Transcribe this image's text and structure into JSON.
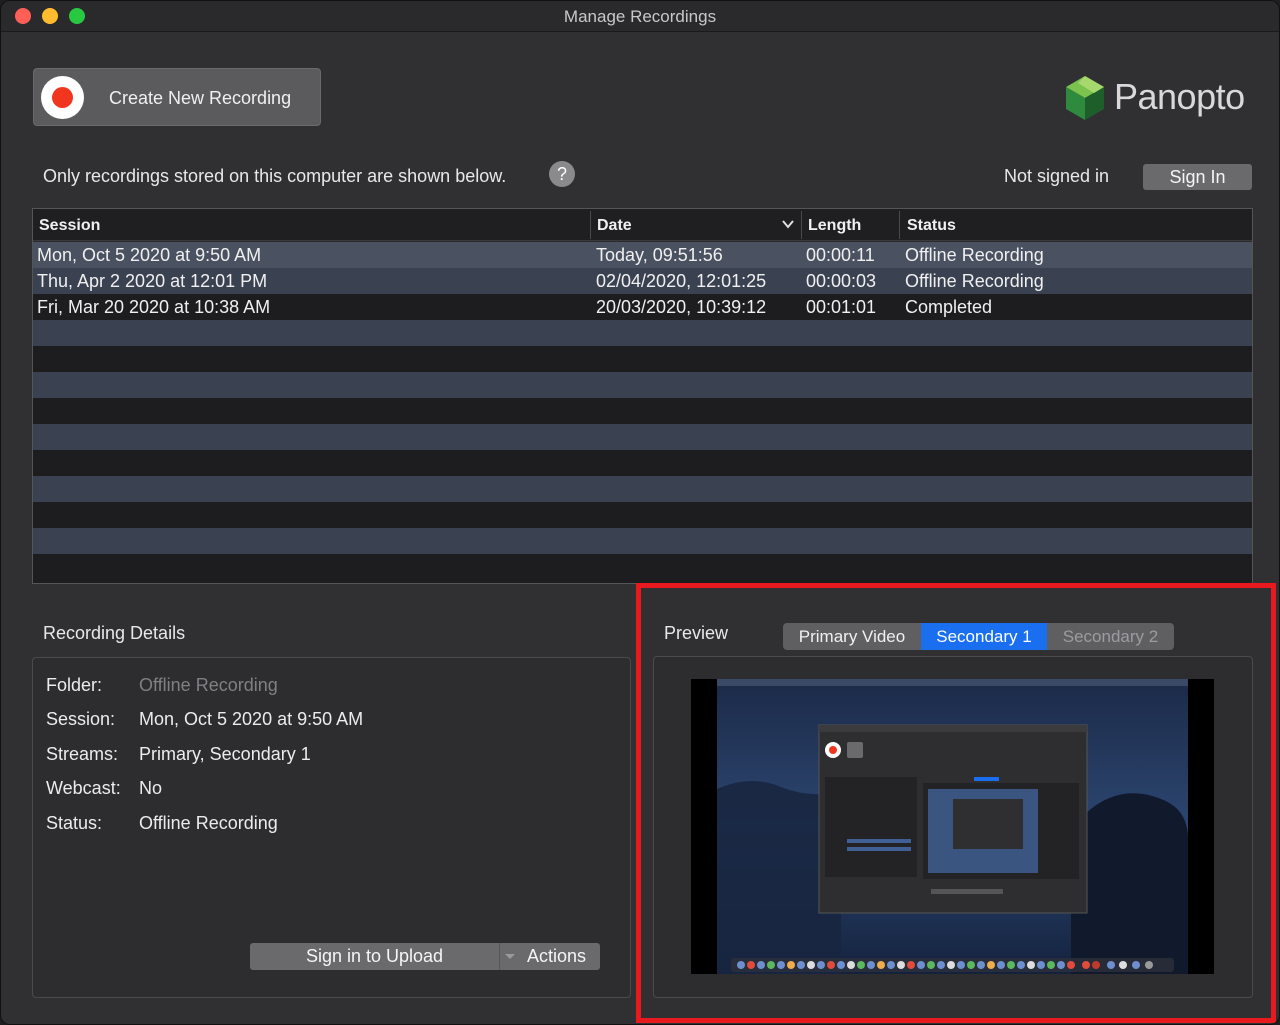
{
  "window": {
    "title": "Manage Recordings"
  },
  "toolbar": {
    "create_label": "Create New Recording"
  },
  "brand": {
    "logo_text": "Panopto",
    "logo_colors": [
      "#6cbf47",
      "#2e8b3e",
      "#1d5e2b"
    ]
  },
  "info": {
    "text": "Only recordings stored on this computer are shown below.",
    "help_label": "?"
  },
  "account": {
    "status": "Not signed in",
    "signin_label": "Sign In"
  },
  "table": {
    "headers": {
      "session": "Session",
      "date": "Date",
      "length": "Length",
      "status": "Status"
    },
    "rows": [
      {
        "session": "Mon, Oct 5 2020 at 9:50 AM",
        "date": "Today, 09:51:56",
        "length": "00:00:11",
        "status": "Offline Recording"
      },
      {
        "session": "Thu, Apr 2 2020 at 12:01 PM",
        "date": "02/04/2020, 12:01:25",
        "length": "00:00:03",
        "status": "Offline Recording"
      },
      {
        "session": "Fri, Mar 20 2020 at 10:38 AM",
        "date": "20/03/2020, 10:39:12",
        "length": "00:01:01",
        "status": "Completed"
      }
    ]
  },
  "details": {
    "title": "Recording Details",
    "fields": [
      {
        "label": "Folder:",
        "value": "Offline Recording"
      },
      {
        "label": "Session:",
        "value": "Mon, Oct 5 2020 at 9:50 AM"
      },
      {
        "label": "Streams:",
        "value": "Primary, Secondary 1"
      },
      {
        "label": "Webcast:",
        "value": "No"
      },
      {
        "label": "Status:",
        "value": "Offline Recording"
      }
    ],
    "upload_label": "Sign in to Upload",
    "actions_label": "Actions"
  },
  "preview": {
    "title": "Preview",
    "tabs": [
      {
        "label": "Primary Video"
      },
      {
        "label": "Secondary 1"
      },
      {
        "label": "Secondary 2"
      }
    ]
  },
  "colors": {
    "accent": "#1a6ef0",
    "record": "#f0361f",
    "highlight": "#e8191f"
  }
}
